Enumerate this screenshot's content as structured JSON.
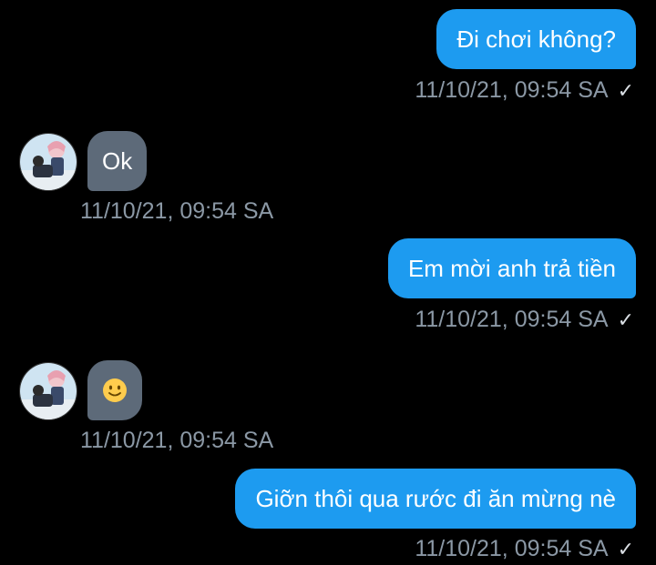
{
  "messages": [
    {
      "direction": "outgoing",
      "text": "Đi chơi không?",
      "timestamp": "11/10/21, 09:54 SA",
      "status_icon": "check-icon"
    },
    {
      "direction": "incoming",
      "text": "Ok",
      "timestamp": "11/10/21, 09:54 SA",
      "avatar": "avatar"
    },
    {
      "direction": "outgoing",
      "text": "Em mời anh trả tiền",
      "timestamp": "11/10/21, 09:54 SA",
      "status_icon": "check-icon"
    },
    {
      "direction": "incoming",
      "text": "",
      "emoji": "smiling-face-emoji",
      "timestamp": "11/10/21, 09:54 SA",
      "avatar": "avatar"
    },
    {
      "direction": "outgoing",
      "text": "Giỡn thôi qua rước đi ăn mừng nè",
      "timestamp": "11/10/21, 09:54 SA",
      "status_icon": "check-icon"
    }
  ],
  "colors": {
    "background": "#000000",
    "outgoing_bubble": "#1d9bf0",
    "incoming_bubble": "#5d6a79",
    "timestamp": "#8b98a5"
  },
  "check_glyph": "✓"
}
